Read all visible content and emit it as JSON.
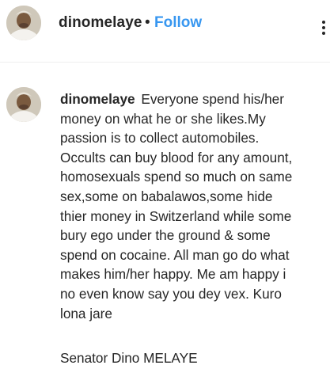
{
  "header": {
    "username": "dinomelaye",
    "separator": "•",
    "follow_label": "Follow",
    "more_icon": "more-horizontal-icon"
  },
  "comment": {
    "username": "dinomelaye",
    "lines": [
      "Everyone spend his/her",
      "money on what he or she likes.My",
      "passion is to collect automobiles.",
      "Occults can buy blood for any amount,",
      "homosexuals spend so much on same",
      "sex,some on babalawos,some hide",
      "thier money in Switzerland while some",
      "bury ego under the ground & some",
      "spend on cocaine. All man go do what",
      "makes him/her happy. Me am happy i",
      "no even know say you dey vex. Kuro",
      "lona jare"
    ],
    "signature": "Senator Dino MELAYE"
  },
  "colors": {
    "accent": "#3897f0",
    "text": "#262626",
    "divider": "#efefef"
  }
}
